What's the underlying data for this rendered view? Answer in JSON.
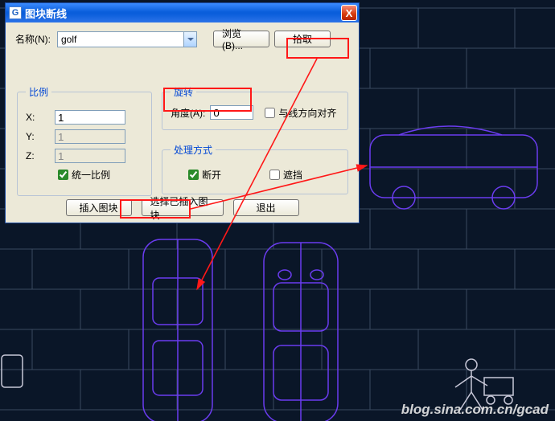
{
  "colors": {
    "accent": "#0046d5",
    "highlight": "#ff1818",
    "cad_line": "#6b3cf0"
  },
  "dialog": {
    "title": "图块断线",
    "close_icon": "X",
    "name_label": "名称(N):",
    "name_value": "golf",
    "browse_label": "浏览(B)...",
    "pick_label": "拾取"
  },
  "scale": {
    "legend": "比例",
    "x_label": "X:",
    "y_label": "Y:",
    "z_label": "Z:",
    "x_value": "1",
    "y_value": "1",
    "z_value": "1",
    "uniform_label": "统一比例",
    "uniform_checked": true
  },
  "rotation": {
    "legend": "旋转",
    "angle_label": "角度(A):",
    "angle_value": "0",
    "align_label": "与线方向对齐",
    "align_checked": false
  },
  "process": {
    "legend": "处理方式",
    "break_label": "断开",
    "break_checked": true,
    "occlude_label": "遮挡",
    "occlude_checked": false
  },
  "buttons": {
    "insert": "插入图块",
    "select_insert": "选择已插入图块",
    "exit": "退出"
  },
  "watermark": "blog.sina.com.cn/gcad"
}
